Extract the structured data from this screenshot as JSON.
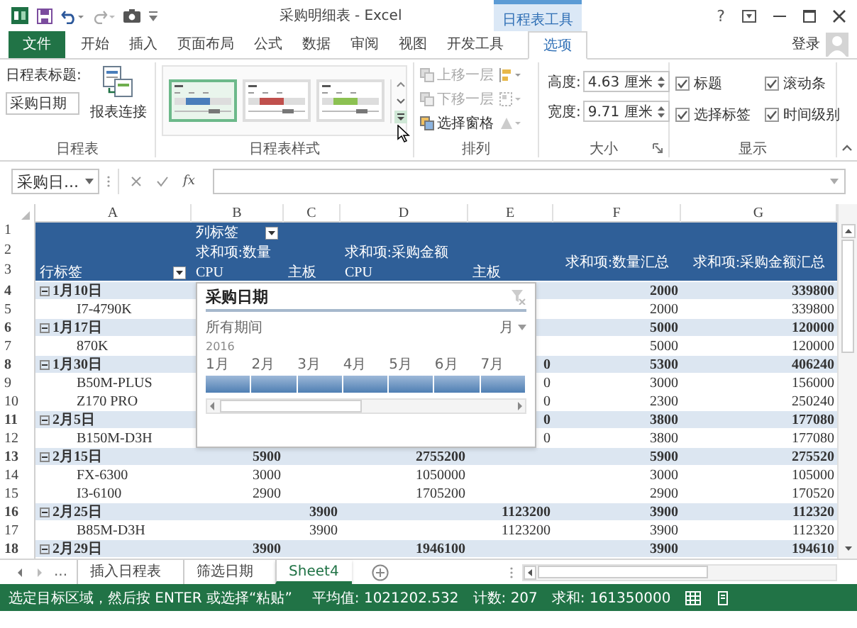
{
  "title_bar": {
    "title": "采购明细表 - Excel",
    "context_label": "日程表工具",
    "help": "?"
  },
  "tabs": [
    {
      "label": "文件",
      "kind": "file",
      "selected": false
    },
    {
      "label": "开始",
      "kind": "tab",
      "selected": false
    },
    {
      "label": "插入",
      "kind": "tab",
      "selected": false
    },
    {
      "label": "页面布局",
      "kind": "tab",
      "selected": false
    },
    {
      "label": "公式",
      "kind": "tab",
      "selected": false
    },
    {
      "label": "数据",
      "kind": "tab",
      "selected": false
    },
    {
      "label": "审阅",
      "kind": "tab",
      "selected": false
    },
    {
      "label": "视图",
      "kind": "tab",
      "selected": false
    },
    {
      "label": "开发工具",
      "kind": "tab",
      "selected": false
    },
    {
      "label": "选项",
      "kind": "tab",
      "selected": true
    }
  ],
  "account": {
    "label": "登录"
  },
  "ribbon": {
    "timeline_group": {
      "caption_label": "日程表标题:",
      "caption_value": "采购日期",
      "connections_label": "报表连接",
      "name": "日程表"
    },
    "styles_group": {
      "name": "日程表样式",
      "styles": [
        {
          "color": "#4a7ebb",
          "selected": true
        },
        {
          "color": "#c0504d",
          "selected": false
        },
        {
          "color": "#8cc152",
          "selected": false
        }
      ]
    },
    "arrange_group": {
      "name": "排列",
      "items": [
        {
          "label": "上移一层",
          "disabled": true
        },
        {
          "label": "下移一层",
          "disabled": true
        },
        {
          "label": "选择窗格",
          "disabled": false
        }
      ]
    },
    "size_group": {
      "name": "大小",
      "fields": [
        {
          "label": "高度:",
          "value": "4.63 厘米"
        },
        {
          "label": "宽度:",
          "value": "9.71 厘米"
        }
      ]
    },
    "show_group": {
      "name": "显示",
      "options": [
        {
          "label": "标题",
          "checked": true
        },
        {
          "label": "滚动条",
          "checked": true
        },
        {
          "label": "选择标签",
          "checked": true
        },
        {
          "label": "时间级别",
          "checked": true
        }
      ]
    }
  },
  "formula_bar": {
    "name_box": "采购日...",
    "function_label": "fx"
  },
  "sheet": {
    "columns": [
      "A",
      "B",
      "C",
      "D",
      "E",
      "F",
      "G"
    ],
    "header_numbers": [
      "1",
      "2",
      "3"
    ],
    "header": {
      "row_1": {
        "b": "列标签"
      },
      "row_2": {
        "b": "求和项:数量",
        "d": "求和项:采购金额"
      },
      "row_3": {
        "a": "行标签",
        "b": "CPU",
        "c": "主板",
        "d": "CPU",
        "e": "主板"
      },
      "totals": {
        "f": "求和项:数量汇总",
        "g": "求和项:采购金额汇总"
      }
    },
    "rows": [
      {
        "number": "4",
        "kind": "group",
        "expanded": true,
        "cells": {
          "a": "1月10日",
          "f": "2000",
          "g": "339800"
        }
      },
      {
        "number": "5",
        "kind": "item",
        "cells": {
          "a": "I7-4790K",
          "f": "2000",
          "g": "339800"
        }
      },
      {
        "number": "6",
        "kind": "group",
        "expanded": true,
        "cells": {
          "a": "1月17日",
          "f": "5000",
          "g": "120000"
        }
      },
      {
        "number": "7",
        "kind": "item",
        "cells": {
          "a": "870K",
          "f": "5000",
          "g": "120000"
        }
      },
      {
        "number": "8",
        "kind": "group",
        "expanded": true,
        "cells": {
          "a": "1月30日",
          "e": "0",
          "f": "5300",
          "g": "406240"
        }
      },
      {
        "number": "9",
        "kind": "item",
        "cells": {
          "a": "B50M-PLUS",
          "e": "0",
          "f": "3000",
          "g": "156000"
        }
      },
      {
        "number": "10",
        "kind": "item",
        "cells": {
          "a": "Z170 PRO",
          "e": "0",
          "f": "2300",
          "g": "250240"
        }
      },
      {
        "number": "11",
        "kind": "group",
        "expanded": true,
        "cells": {
          "a": "2月5日",
          "e": "0",
          "f": "3800",
          "g": "177080"
        }
      },
      {
        "number": "12",
        "kind": "item",
        "cells": {
          "a": "B150M-D3H",
          "e": "0",
          "f": "3800",
          "g": "177080"
        }
      },
      {
        "number": "13",
        "kind": "group",
        "expanded": true,
        "cells": {
          "a": "2月15日",
          "b": "5900",
          "d": "2755200",
          "f": "5900",
          "g": "275520"
        }
      },
      {
        "number": "14",
        "kind": "item",
        "cells": {
          "a": "FX-6300",
          "b": "3000",
          "d": "1050000",
          "f": "3000",
          "g": "105000"
        }
      },
      {
        "number": "15",
        "kind": "item",
        "cells": {
          "a": "I3-6100",
          "b": "2900",
          "d": "1705200",
          "f": "2900",
          "g": "170520"
        }
      },
      {
        "number": "16",
        "kind": "group",
        "expanded": true,
        "cells": {
          "a": "2月25日",
          "c": "3900",
          "e": "1123200",
          "f": "3900",
          "g": "112320"
        }
      },
      {
        "number": "17",
        "kind": "item",
        "cells": {
          "a": "B85M-D3H",
          "c": "3900",
          "e": "1123200",
          "f": "3900",
          "g": "112320"
        }
      },
      {
        "number": "18",
        "kind": "group",
        "expanded": true,
        "cells": {
          "a": "2月29日",
          "b": "3900",
          "d": "1946100",
          "f": "3900",
          "g": "194610"
        }
      }
    ]
  },
  "timeline": {
    "title": "采购日期",
    "period_label": "所有期间",
    "time_level": "月",
    "year": "2016",
    "months": [
      {
        "label": "1月",
        "selected": true
      },
      {
        "label": "2月",
        "selected": true
      },
      {
        "label": "3月",
        "selected": true
      },
      {
        "label": "4月",
        "selected": true
      },
      {
        "label": "5月",
        "selected": true
      },
      {
        "label": "6月",
        "selected": true
      },
      {
        "label": "7月",
        "selected": true
      }
    ]
  },
  "sheet_tabs": {
    "ellipsis": "...",
    "tabs": [
      {
        "label": "插入日程表",
        "selected": false
      },
      {
        "label": "筛选日期",
        "selected": false
      },
      {
        "label": "Sheet4",
        "selected": true
      }
    ]
  },
  "status_bar": {
    "message": "选定目标区域，然后按 ENTER 或选择“粘贴”",
    "stats": [
      "平均值: 1021202.532",
      "计数: 207",
      "求和: 161350000"
    ]
  }
}
